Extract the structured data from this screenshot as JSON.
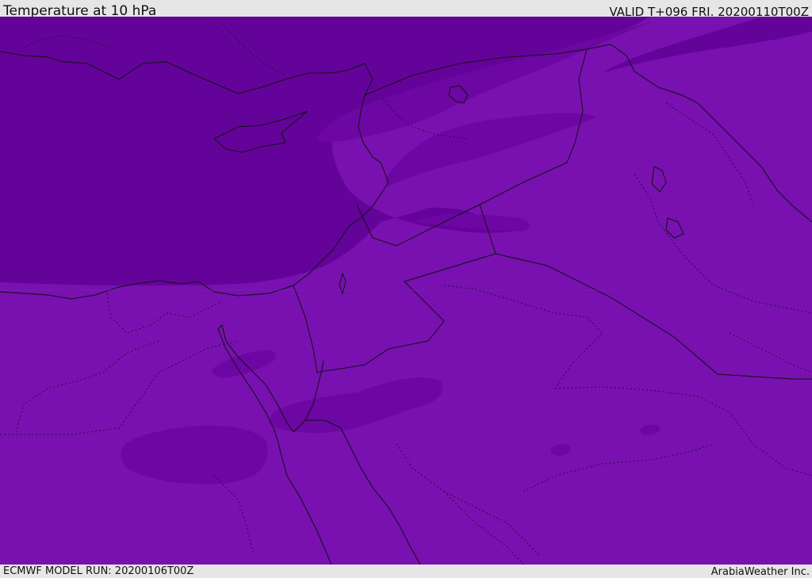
{
  "header": {
    "title": "Temperature at 10 hPa",
    "valid": "VALID T+096 FRI. 20200110T00Z"
  },
  "footer": {
    "model_run": "ECMWF MODEL RUN: 20200106T00Z",
    "credit": "ArabiaWeather Inc."
  },
  "colors": {
    "field_base": "#7811b0",
    "field_dark": "#64039a",
    "field_mid": "#6c07a3",
    "coastline": "#111111",
    "frame_bg": "#e6e6e6"
  }
}
